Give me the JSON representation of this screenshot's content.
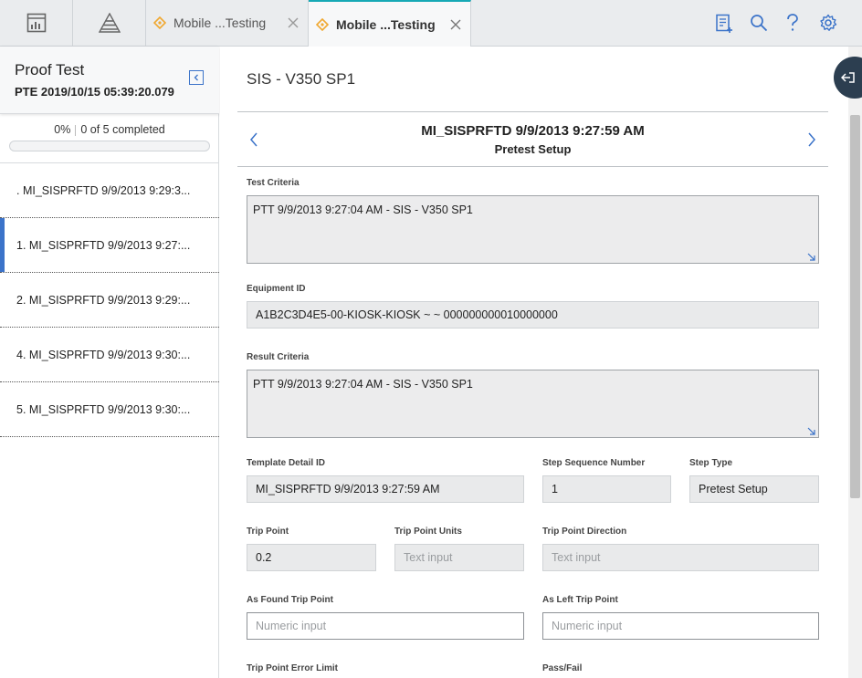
{
  "topbar": {
    "tabs": [
      {
        "label": "Mobile ...Testing"
      },
      {
        "label": "Mobile ...Testing"
      }
    ]
  },
  "left_panel": {
    "title": "Proof Test",
    "subtitle": "PTE 2019/10/15 05:39:20.079",
    "progress_percent_label": "0%",
    "progress_count_label": "0 of 5 completed",
    "progress_fraction": 0,
    "steps": [
      {
        "label": ". MI_SISPRFTD 9/9/2013 9:29:3..."
      },
      {
        "label": "1. MI_SISPRFTD 9/9/2013 9:27:..."
      },
      {
        "label": "2. MI_SISPRFTD 9/9/2013 9:29:..."
      },
      {
        "label": "4. MI_SISPRFTD 9/9/2013 9:30:..."
      },
      {
        "label": "5. MI_SISPRFTD 9/9/2013 9:30:..."
      }
    ]
  },
  "main": {
    "page_title": "SIS - V350 SP1",
    "record_title": "MI_SISPRFTD 9/9/2013 9:27:59 AM",
    "record_subtitle": "Pretest Setup",
    "fields": {
      "test_criteria": {
        "label": "Test Criteria",
        "value": "PTT 9/9/2013 9:27:04 AM - SIS - V350 SP1"
      },
      "equipment_id": {
        "label": "Equipment ID",
        "value": "A1B2C3D4E5-00-KIOSK-KIOSK ~  ~ 000000000010000000"
      },
      "result_criteria": {
        "label": "Result Criteria",
        "value": "PTT 9/9/2013 9:27:04 AM - SIS - V350 SP1"
      },
      "template_detail_id": {
        "label": "Template Detail ID",
        "value": "MI_SISPRFTD 9/9/2013 9:27:59 AM"
      },
      "step_sequence_number": {
        "label": "Step Sequence Number",
        "value": "1"
      },
      "step_type": {
        "label": "Step Type",
        "value": "Pretest Setup"
      },
      "trip_point": {
        "label": "Trip Point",
        "value": "0.2"
      },
      "trip_point_units": {
        "label": "Trip Point Units",
        "placeholder": "Text input"
      },
      "trip_point_direction": {
        "label": "Trip Point Direction",
        "placeholder": "Text input"
      },
      "as_found_trip_point": {
        "label": "As Found Trip Point",
        "placeholder": "Numeric input"
      },
      "as_left_trip_point": {
        "label": "As Left Trip Point",
        "placeholder": "Numeric input"
      },
      "trip_point_error_limit": {
        "label": "Trip Point Error Limit"
      },
      "pass_fail": {
        "label": "Pass/Fail"
      }
    }
  },
  "colors": {
    "accent": "#3b73c9",
    "active_tab_border": "#16a9b5",
    "tab_icon": "#f0a830"
  }
}
